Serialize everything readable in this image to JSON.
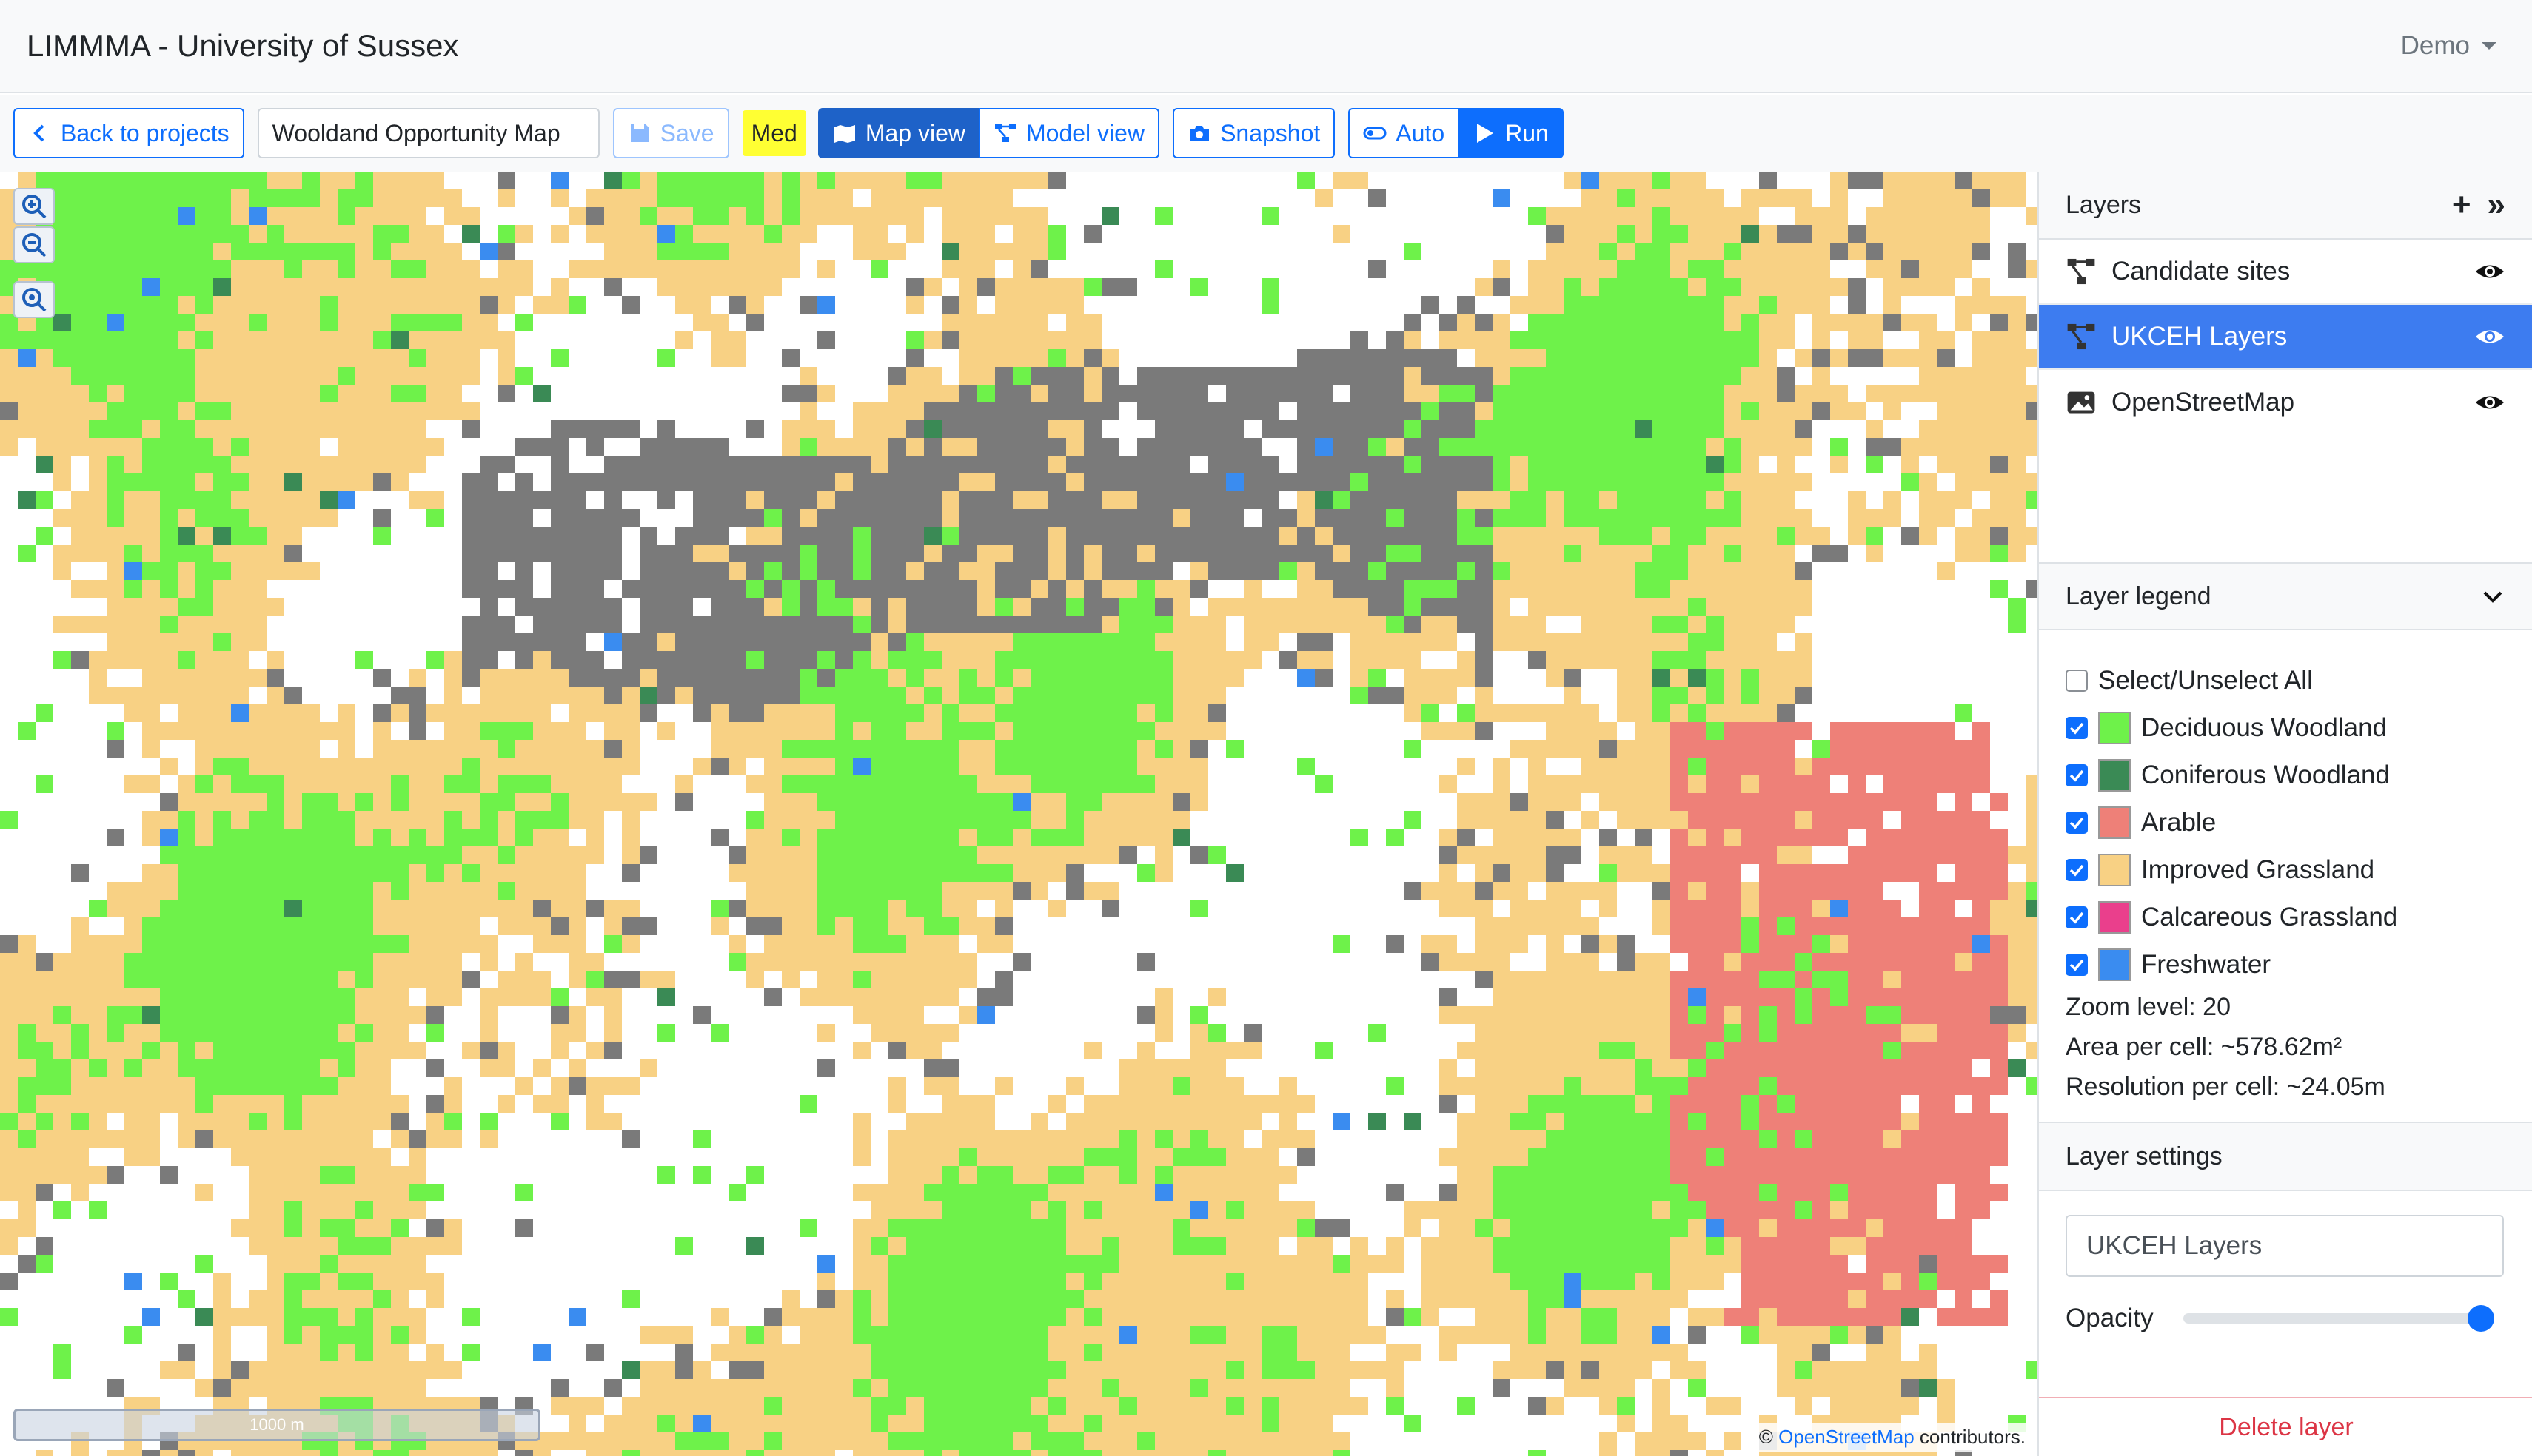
{
  "app": {
    "title": "LIMMMA - University of Sussex",
    "user_menu": "Demo"
  },
  "toolbar": {
    "back_label": "Back to projects",
    "project_name": "Wooldand Opportunity Map",
    "save_label": "Save",
    "quality_badge": "Med",
    "map_view_label": "Map view",
    "model_view_label": "Model view",
    "snapshot_label": "Snapshot",
    "auto_label": "Auto",
    "run_label": "Run"
  },
  "map": {
    "scale_label": "1000 m",
    "attribution_prefix": "©",
    "attribution_link": "OpenStreetMap",
    "attribution_suffix": "contributors.",
    "controls": [
      "zoom-in-icon",
      "zoom-out-icon",
      "zoom-fit-icon"
    ]
  },
  "layers_panel": {
    "title": "Layers",
    "add_icon": "plus-icon",
    "collapse_icon": "double-chevron-right-icon",
    "items": [
      {
        "label": "Candidate sites",
        "icon": "graph-icon",
        "visible": true,
        "selected": false
      },
      {
        "label": "UKCEH Layers",
        "icon": "graph-icon",
        "visible": true,
        "selected": true
      },
      {
        "label": "OpenStreetMap",
        "icon": "image-icon",
        "visible": true,
        "selected": false
      }
    ]
  },
  "legend": {
    "title": "Layer legend",
    "select_all_label": "Select/Unselect All",
    "items": [
      {
        "label": "Deciduous Woodland",
        "color": "#6ef24a",
        "checked": true
      },
      {
        "label": "Coniferous Woodland",
        "color": "#3a8a55",
        "checked": true
      },
      {
        "label": "Arable",
        "color": "#ee8078",
        "checked": true
      },
      {
        "label": "Improved Grassland",
        "color": "#f8d184",
        "checked": true
      },
      {
        "label": "Calcareous Grassland",
        "color": "#ea3f8c",
        "checked": true
      },
      {
        "label": "Freshwater",
        "color": "#3a8cf0",
        "checked": true
      }
    ]
  },
  "info": {
    "zoom_level": "Zoom level: 20",
    "area_per_cell": "Area per cell: ~578.62m²",
    "resolution_per_cell": "Resolution per cell: ~24.05m"
  },
  "settings": {
    "title": "Layer settings",
    "layer_name": "UKCEH Layers",
    "opacity_label": "Opacity",
    "opacity_value": 1.0,
    "delete_label": "Delete layer"
  }
}
